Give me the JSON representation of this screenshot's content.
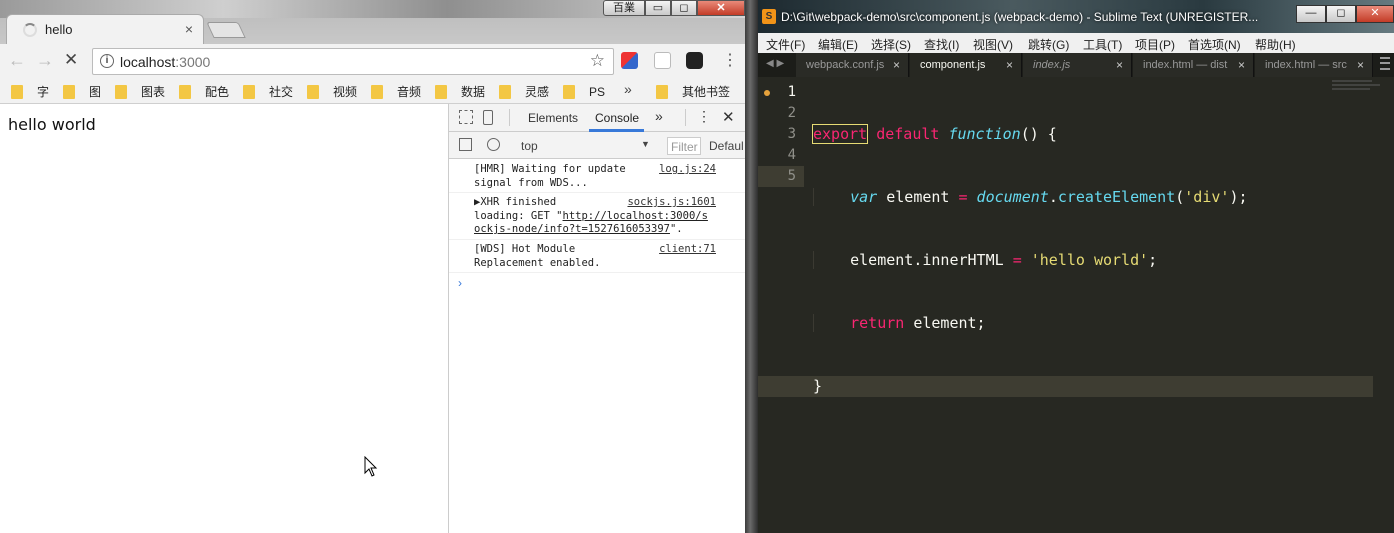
{
  "chrome": {
    "tab_title": "hello",
    "tab_close": "×",
    "window_extra": "百業",
    "win_min": "▭",
    "win_max": "◻",
    "win_close": "✕",
    "url_host": "localhost",
    "url_port": ":3000",
    "bookmarks": [
      "字",
      "图",
      "图表",
      "配色",
      "社交",
      "视频",
      "音频",
      "数据",
      "灵感",
      "PS"
    ],
    "bookmarks_more": "»",
    "other_bookmarks": "其他书签",
    "page_text": "hello world"
  },
  "devtools": {
    "tabs": {
      "elements": "Elements",
      "console": "Console",
      "more": "»"
    },
    "context": "top",
    "filter_placeholder": "Filter",
    "levels": "Defaul",
    "console": [
      {
        "line1": "[HMR] Waiting for update",
        "line2": "signal from WDS...",
        "source": "log.js:24"
      },
      {
        "line1": "▶XHR finished",
        "line2_prefix": "loading: GET \"",
        "link1": "http://localhost:3000/s",
        "link2": "ockjs-node/info?t=1527616053397",
        "line3_suffix": "\".",
        "source": "sockjs.js:1601"
      },
      {
        "line1": "[WDS] Hot Module",
        "line2": "Replacement enabled.",
        "source": "client:71"
      }
    ],
    "prompt": "›"
  },
  "sublime": {
    "title": "D:\\Git\\webpack-demo\\src\\component.js (webpack-demo) - Sublime Text (UNREGISTER...",
    "menu": [
      "文件(F)",
      "编辑(E)",
      "选择(S)",
      "查找(I)",
      "视图(V)",
      "跳转(G)",
      "工具(T)",
      "项目(P)",
      "首选项(N)",
      "帮助(H)"
    ],
    "tabs": [
      {
        "label": "webpack.conf.js",
        "active": false,
        "italic": false
      },
      {
        "label": "component.js",
        "active": true,
        "italic": false
      },
      {
        "label": "index.js",
        "active": false,
        "italic": true
      },
      {
        "label": "index.html — dist",
        "active": false,
        "italic": false
      },
      {
        "label": "index.html — src",
        "active": false,
        "italic": false
      }
    ],
    "line_numbers": [
      "1",
      "2",
      "3",
      "4",
      "5"
    ],
    "code": {
      "l1_export": "export",
      "l1_default": " default ",
      "l1_function": "function",
      "l1_rest": "() {",
      "l2_var": "var",
      "l2_name": " element ",
      "l2_eq": "=",
      "l2_doc": " document",
      "l2_dot": ".",
      "l2_fn": "createElement",
      "l2_open": "(",
      "l2_str": "'div'",
      "l2_close": ");",
      "l3_lhs": "element.innerHTML ",
      "l3_eq": "=",
      "l3_str": " 'hello world'",
      "l3_end": ";",
      "l4_return": "return",
      "l4_rest": " element;",
      "l5": "}"
    }
  }
}
